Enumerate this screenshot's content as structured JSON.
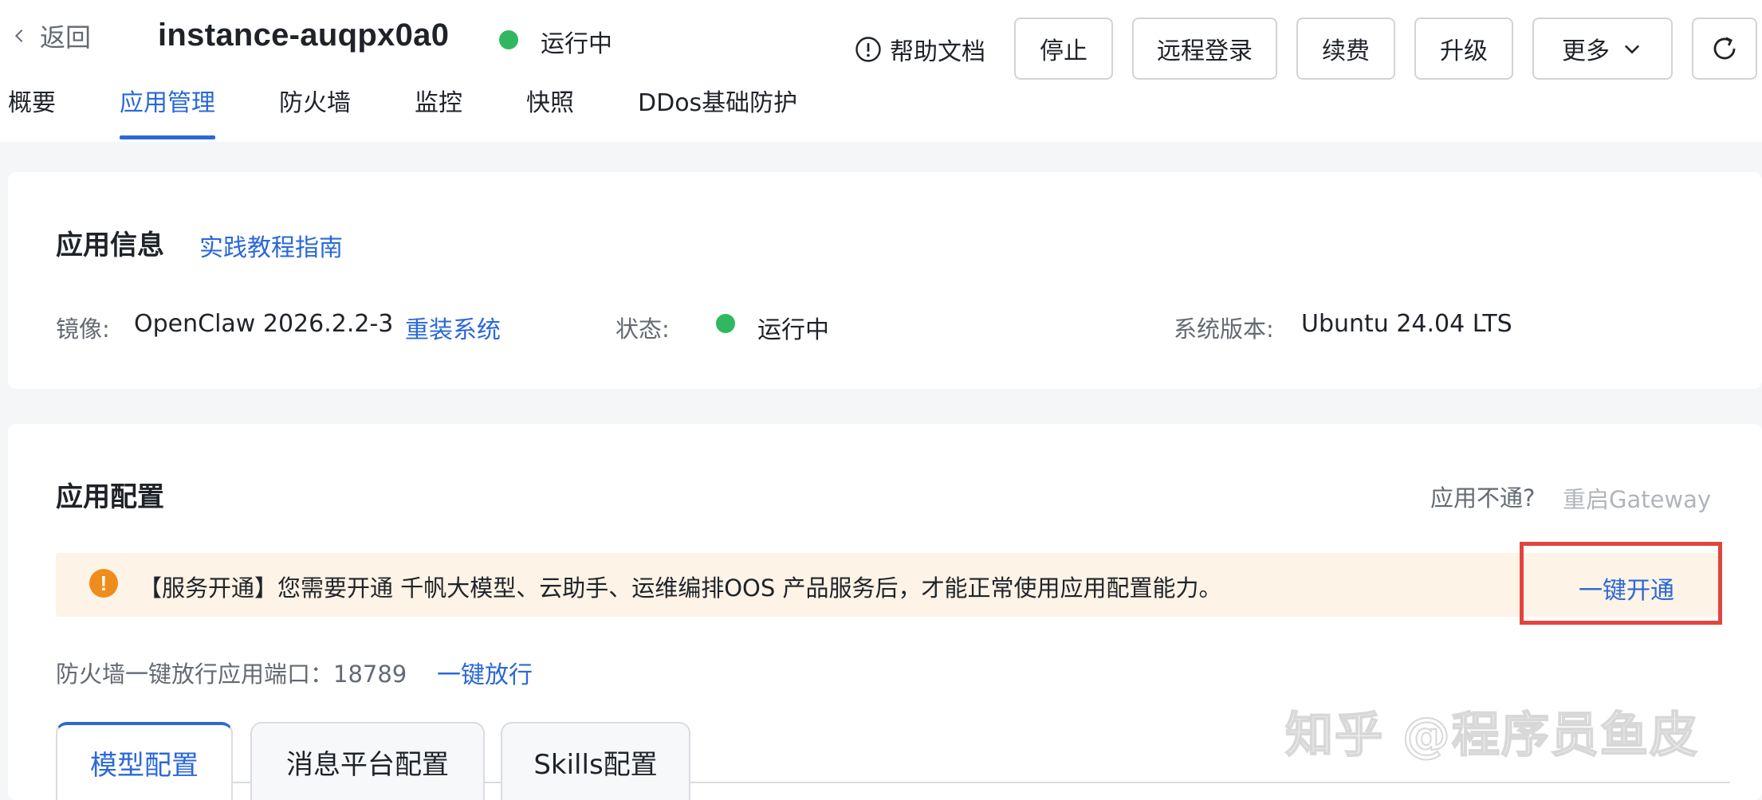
{
  "header": {
    "back_label": "返回",
    "instance_name": "instance-auqpx0a0",
    "status_text": "运行中",
    "status_color": "#2fb860",
    "help_label": "帮助文档",
    "buttons": {
      "stop": "停止",
      "remote_login": "远程登录",
      "renew": "续费",
      "upgrade": "升级",
      "more": "更多"
    }
  },
  "tabs": [
    {
      "label": "概要"
    },
    {
      "label": "应用管理"
    },
    {
      "label": "防火墙"
    },
    {
      "label": "监控"
    },
    {
      "label": "快照"
    },
    {
      "label": "DDos基础防护"
    }
  ],
  "active_tab": "应用管理",
  "app_info": {
    "title": "应用信息",
    "guide_link": "实践教程指南",
    "image_label": "镜像:",
    "image_value": "OpenClaw 2026.2.2-3",
    "reinstall_link": "重装系统",
    "status_label": "状态:",
    "status_value": "运行中",
    "os_label": "系统版本:",
    "os_value": "Ubuntu 24.04 LTS"
  },
  "app_config": {
    "title": "应用配置",
    "trouble_label": "应用不通?",
    "restart_gateway": "重启Gateway",
    "alert_text": "【服务开通】您需要开通 千帆大模型、云助手、运维编排OOS 产品服务后，才能正常使用应用配置能力。",
    "alert_action": "一键开通",
    "firewall_label": "防火墙一键放行应用端口：18789",
    "firewall_link": "一键放行",
    "config_tabs": [
      {
        "label": "模型配置"
      },
      {
        "label": "消息平台配置"
      },
      {
        "label": "Skills配置"
      }
    ]
  },
  "watermark": "知乎 @程序员鱼皮",
  "colors": {
    "accent": "#2b68d8",
    "alert_bg": "#fdf3e6",
    "alert_icon": "#f08c1b",
    "highlight": "#e0453e"
  }
}
